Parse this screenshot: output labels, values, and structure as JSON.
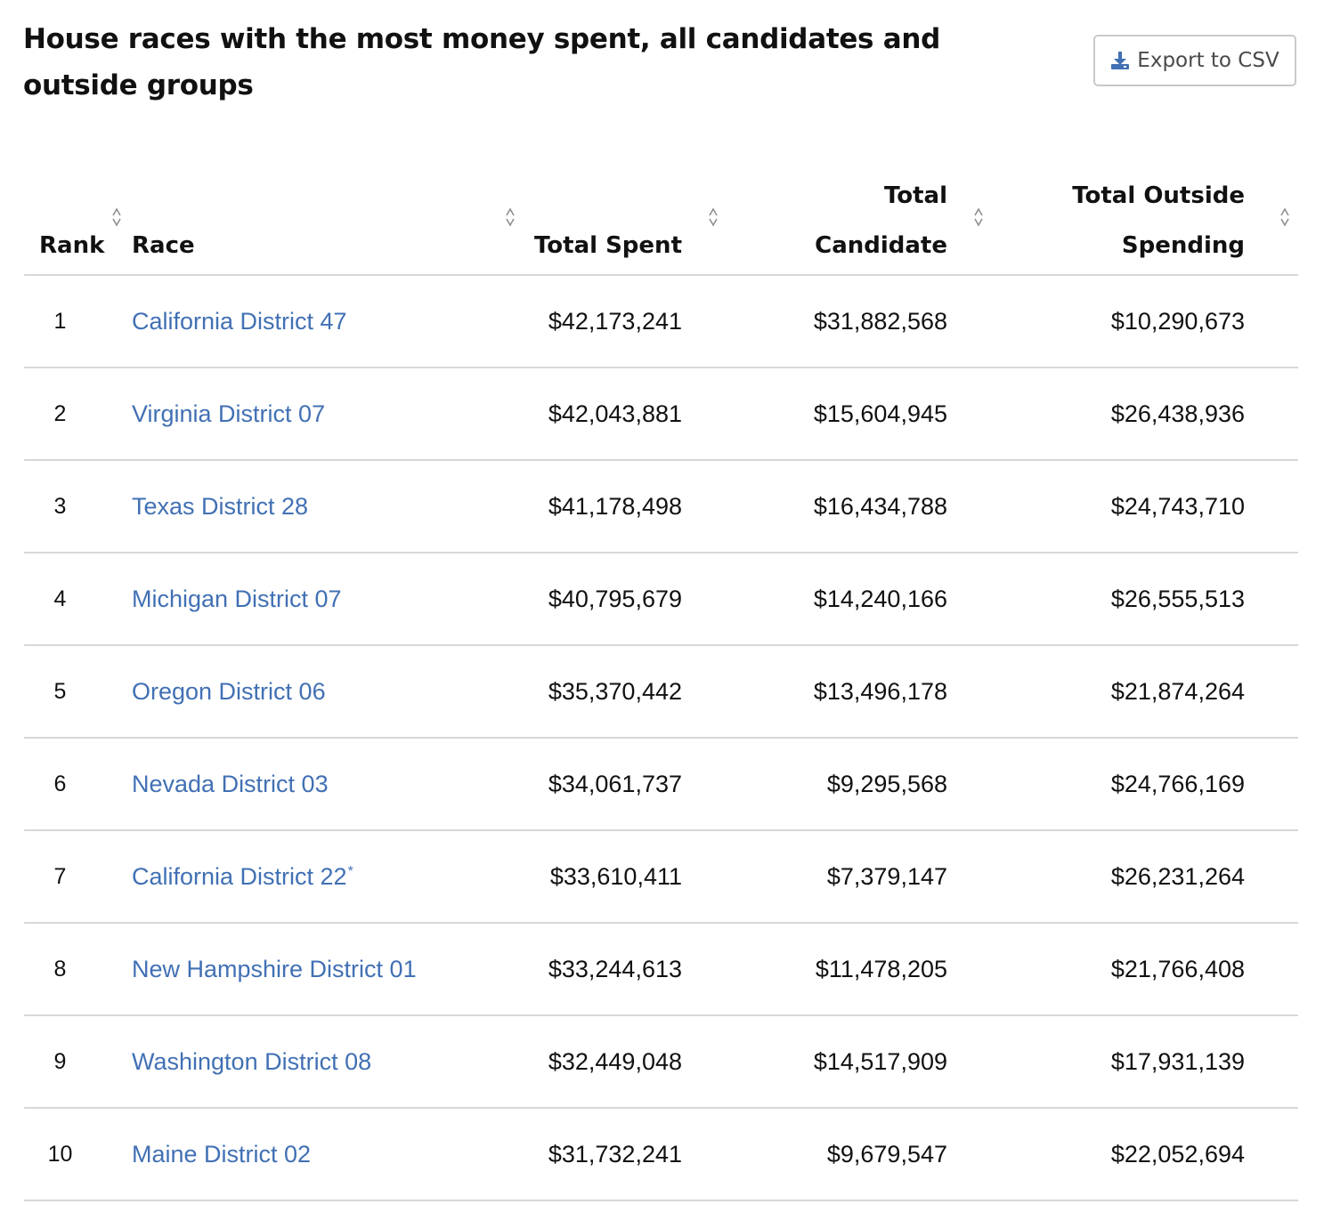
{
  "title": "House races with the most money spent, all candidates and outside groups",
  "export": {
    "label": "Export to CSV",
    "icon": "download-icon"
  },
  "table": {
    "headers": {
      "rank": "Rank",
      "race": "Race",
      "total_spent": "Total Spent",
      "total_candidate_line1": "Total",
      "total_candidate_line2": "Candidate",
      "total_outside_line1": "Total Outside",
      "total_outside_line2": "Spending"
    },
    "rows": [
      {
        "rank": "1",
        "race": "California District 47",
        "mark": "",
        "total_spent": "$42,173,241",
        "total_candidate": "$31,882,568",
        "total_outside": "$10,290,673"
      },
      {
        "rank": "2",
        "race": "Virginia District 07",
        "mark": "",
        "total_spent": "$42,043,881",
        "total_candidate": "$15,604,945",
        "total_outside": "$26,438,936"
      },
      {
        "rank": "3",
        "race": "Texas District 28",
        "mark": "",
        "total_spent": "$41,178,498",
        "total_candidate": "$16,434,788",
        "total_outside": "$24,743,710"
      },
      {
        "rank": "4",
        "race": "Michigan District 07",
        "mark": "",
        "total_spent": "$40,795,679",
        "total_candidate": "$14,240,166",
        "total_outside": "$26,555,513"
      },
      {
        "rank": "5",
        "race": "Oregon District 06",
        "mark": "",
        "total_spent": "$35,370,442",
        "total_candidate": "$13,496,178",
        "total_outside": "$21,874,264"
      },
      {
        "rank": "6",
        "race": "Nevada District 03",
        "mark": "",
        "total_spent": "$34,061,737",
        "total_candidate": "$9,295,568",
        "total_outside": "$24,766,169"
      },
      {
        "rank": "7",
        "race": "California District 22",
        "mark": "*",
        "total_spent": "$33,610,411",
        "total_candidate": "$7,379,147",
        "total_outside": "$26,231,264"
      },
      {
        "rank": "8",
        "race": "New Hampshire District 01",
        "mark": "",
        "total_spent": "$33,244,613",
        "total_candidate": "$11,478,205",
        "total_outside": "$21,766,408"
      },
      {
        "rank": "9",
        "race": "Washington District 08",
        "mark": "",
        "total_spent": "$32,449,048",
        "total_candidate": "$14,517,909",
        "total_outside": "$17,931,139"
      },
      {
        "rank": "10",
        "race": "Maine District 02",
        "mark": "",
        "total_spent": "$31,732,241",
        "total_candidate": "$9,679,547",
        "total_outside": "$22,052,694"
      }
    ]
  },
  "colors": {
    "link": "#4170b4",
    "border": "#d8d8d8",
    "sort_icon": "#8a8a8a",
    "export_icon": "#4170b4"
  }
}
